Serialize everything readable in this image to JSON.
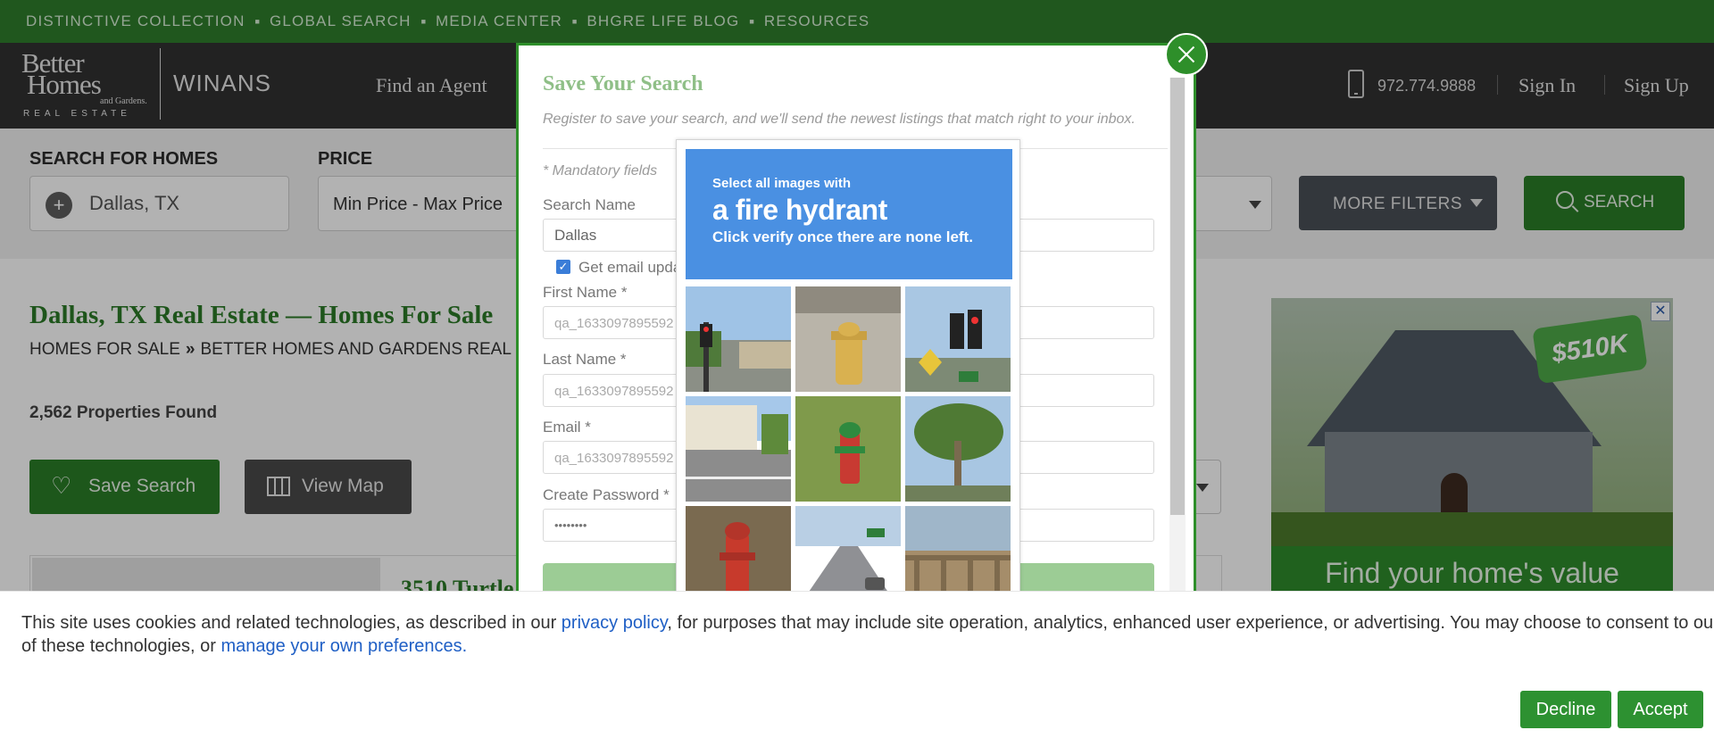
{
  "topnav": [
    "DISTINCTIVE COLLECTION",
    "GLOBAL SEARCH",
    "MEDIA CENTER",
    "BHGRE LIFE BLOG",
    "RESOURCES"
  ],
  "header": {
    "logo": {
      "line1": "Better",
      "line2": "Homes",
      "line3": "and Gardens.",
      "line4": "REAL ESTATE"
    },
    "brand": "WINANS",
    "find_agent": "Find an Agent",
    "phone": "972.774.9888",
    "sign_in": "Sign In",
    "sign_up": "Sign Up"
  },
  "search": {
    "location_label": "SEARCH FOR HOMES",
    "location_value": "Dallas, TX",
    "price_label": "PRICE",
    "price_value": "Min Price  -  Max Price",
    "more_filters": "MORE FILTERS",
    "search_button": "SEARCH"
  },
  "main": {
    "title": "Dallas, TX Real Estate — Homes For Sale",
    "breadcrumb": [
      "HOMES FOR SALE",
      "BETTER HOMES AND GARDENS REAL ESTATE"
    ],
    "breadcrumb_sep": "»",
    "count": "2,562 Properties Found",
    "save_search": "Save Search",
    "view_map": "View Map",
    "listing_address": "3510 Turtle"
  },
  "ad": {
    "price": "$510K",
    "caption": "Find your home's value"
  },
  "modal": {
    "title": "Save Your Search",
    "description": "Register to save your search, and we'll send the newest listings that match right to your inbox.",
    "mandatory": "* Mandatory fields",
    "search_name_label": "Search Name",
    "search_name_value": "Dallas",
    "email_updates_label": "Get email updates",
    "email_updates_checked": true,
    "first_name_label": "First Name *",
    "first_name_value": "qa_1633097895592",
    "last_name_label": "Last Name *",
    "last_name_value": "qa_1633097895592",
    "email_label": "Email *",
    "email_value": "qa_1633097895592",
    "password_label": "Create Password *",
    "password_value": "••••••••"
  },
  "captcha": {
    "prompt_small": "Select all images with",
    "prompt_object": "a fire hydrant",
    "prompt_instruction": "Click verify once there are none left.",
    "tiles": [
      "street-traffic-light",
      "yellow-fire-hydrant",
      "traffic-light-street-sign",
      "building-street",
      "green-red-fire-hydrant",
      "palm-trees",
      "red-fire-hydrant",
      "highway-cars",
      "bridge-railing"
    ]
  },
  "cookie": {
    "text_1": "This site uses cookies and related technologies, as described in our ",
    "link_privacy": "privacy policy",
    "text_2": ", for purposes that may include site operation, analytics, enhanced user experience, or advertising. You may choose to consent to our use of these technologies, or ",
    "link_prefs": "manage your own preferences.",
    "decline": "Decline",
    "accept": "Accept"
  }
}
